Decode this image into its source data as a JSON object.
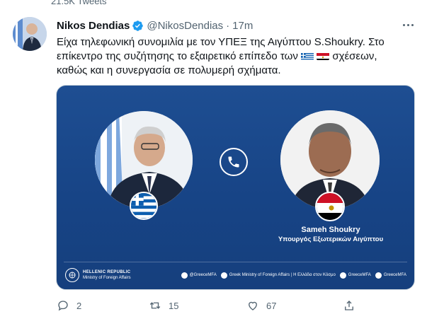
{
  "top": {
    "count_text": "21.5K Tweets"
  },
  "tweet": {
    "author_name": "Nikos Dendias",
    "handle": "@NikosDendias",
    "separator": "·",
    "time": "17m",
    "text_line1": "Είχα τηλεφωνική συνομιλία με τον ΥΠΕΞ της Αιγύπτου S.Shoukry. Στο",
    "text_line2_pre": "επίκεντρο της συζήτησης το εξαιρετικό επίπεδο των",
    "text_line2_post": "σχέσεων,",
    "text_line3": "καθώς και η συνεργασία σε πολυμερή σχήματα."
  },
  "media": {
    "person_name": "Sameh Shoukry",
    "person_role": "Υπουργός Εξωτερικών Αιγύπτου",
    "footer": {
      "republic": "HELLENIC REPUBLIC",
      "ministry": "Ministry of Foreign Affairs",
      "twitter": "@GreeceMFA",
      "facebook": "Greek Ministry of Foreign Affairs | Η Ελλάδα στον Κόσμο",
      "instagram": "GreeceMFA",
      "youtube": "GreeceMFA"
    }
  },
  "actions": {
    "reply_count": "2",
    "retweet_count": "15",
    "like_count": "67"
  },
  "colors": {
    "accent": "#1d9bf0",
    "media_bg": "#1b4a8c",
    "muted": "#536471"
  },
  "icons": [
    "verified-icon",
    "more-icon",
    "phone-icon",
    "reply-icon",
    "retweet-icon",
    "like-icon",
    "share-icon"
  ]
}
